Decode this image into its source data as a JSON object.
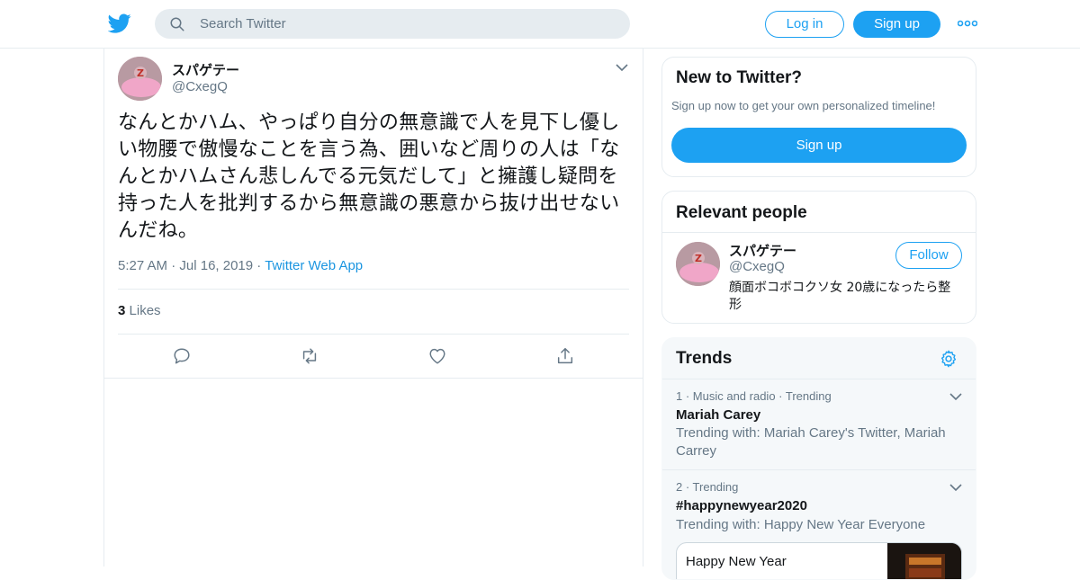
{
  "header": {
    "search_placeholder": "Search Twitter",
    "login_label": "Log in",
    "signup_label": "Sign up"
  },
  "tweet": {
    "display_name": "スパゲテー",
    "handle": "@CxegQ",
    "text": "なんとかハム、やっぱり自分の無意識で人を見下し優しい物腰で傲慢なことを言う為、囲いなど周りの人は「なんとかハムさん悲しんでる元気だして」と擁護し疑問を持った人を批判するから無意識の悪意から抜け出せないんだね。",
    "time": "5:27 AM",
    "date": "Jul 16, 2019",
    "source": "Twitter Web App",
    "likes_count": "3",
    "likes_label": "Likes"
  },
  "sidebar": {
    "new_to_twitter": {
      "title": "New to Twitter?",
      "subtitle": "Sign up now to get your own personalized timeline!",
      "cta": "Sign up"
    },
    "relevant_people": {
      "title": "Relevant people",
      "person": {
        "display_name": "スパゲテー",
        "handle": "@CxegQ",
        "bio": "顔面ボコボコクソ女 20歳になったら整形",
        "follow_label": "Follow"
      }
    },
    "trends": {
      "title": "Trends",
      "items": [
        {
          "meta": "1 · Music and radio · Trending",
          "name": "Mariah Carey",
          "with": "Trending with: Mariah Carey's Twitter, Mariah Carrey"
        },
        {
          "meta": "2 · Trending",
          "name": "#happynewyear2020",
          "with": "Trending with: Happy New Year Everyone",
          "media_caption": "Happy New Year"
        }
      ]
    }
  },
  "colors": {
    "brand_blue": "#1da1f2",
    "link_blue": "#1b95e0",
    "text_primary": "#14171a",
    "text_secondary": "#657786",
    "border": "#e6ecf0"
  }
}
